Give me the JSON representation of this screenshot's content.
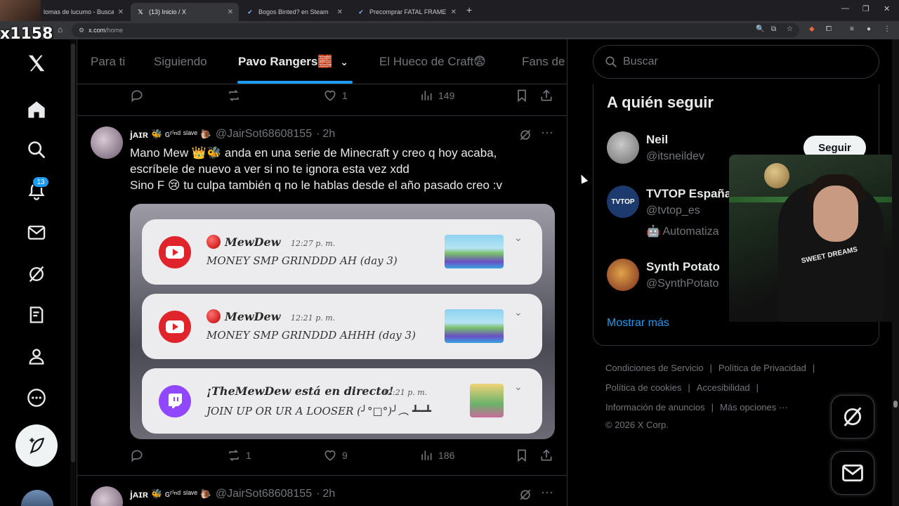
{
  "browser": {
    "tabs": [
      {
        "label": "lomas de lucumo - Buscar c",
        "active": false
      },
      {
        "label": "(13) Inicio / X",
        "active": true
      },
      {
        "label": "Bogos Binted? en Steam",
        "active": false
      },
      {
        "label": "Precomprar FATAL FRAME II: Cr",
        "active": false
      }
    ],
    "url_host": "x.com",
    "url_path": "/home"
  },
  "overlay": {
    "streamer_tag": "x1158"
  },
  "nav": {
    "notifications_badge": "13"
  },
  "timeline": {
    "tabs": [
      "Para ti",
      "Siguiendo",
      "Pavo Rangers🧱",
      "El Hueco de Craft😨",
      "Fans de"
    ],
    "active_tab": "Pavo Rangers🧱",
    "prev_post_actions": {
      "replies": "",
      "reposts": "",
      "likes": "1",
      "views": "149"
    },
    "post": {
      "display_name": "jᴀɪʀ",
      "name_decor": "🐝 ɢʳⁱⁿᵈ ˢˡᵃᵛᵉ 🐌",
      "handle": "@JairSot68608155",
      "time": "2h",
      "text_lines": [
        "Mano Mew 👑🐝 anda en una serie de Minecraft y creo q hoy acaba,",
        "escríbele de nuevo a ver si no te ignora esta vez xdd",
        "Sino F 😢 tu culpa también q no le hablas desde el año pasado creo :v"
      ],
      "notifications": [
        {
          "app": "youtube",
          "who": "MewDew",
          "time": "12:27 p. m.",
          "message": "MONEY SMP GRINDDD AH (day 3)"
        },
        {
          "app": "youtube",
          "who": "MewDew",
          "time": "12:21 p. m.",
          "message": "MONEY SMP GRINDDD AHHH (day 3)"
        },
        {
          "app": "twitch",
          "who": "¡TheMewDew está en directo!",
          "time": "12:21 p. m.",
          "message": "JOIN UP OR UR A LOOSER (╯°□°)╯︵ ┻━┻"
        }
      ],
      "actions": {
        "replies": "",
        "reposts": "1",
        "likes": "9",
        "views": "186"
      }
    },
    "next_post": {
      "display_name": "jᴀɪʀ",
      "name_decor": "🐝 ɢʳⁱⁿᵈ ˢˡᵃᵛᵉ 🐌",
      "handle": "@JairSot68608155",
      "time": "2h"
    }
  },
  "sidebar": {
    "search_placeholder": "Buscar",
    "who_to_follow": {
      "title": "A quién seguir",
      "accounts": [
        {
          "name": "Neil",
          "handle": "@itsneildev",
          "bio": ""
        },
        {
          "name": "TVTOP España",
          "handle": "@tvtop_es",
          "bio": "🤖 Automatiza"
        },
        {
          "name": "Synth Potato",
          "handle": "@SynthPotato",
          "bio": ""
        }
      ],
      "follow_label": "Seguir",
      "show_more": "Mostrar más"
    },
    "footer": {
      "links": [
        "Condiciones de Servicio",
        "Política de Privacidad",
        "Política de cookies",
        "Accesibilidad",
        "Información de anuncios",
        "Más opciones ···"
      ],
      "copyright": "© 2026 X Corp."
    },
    "webcam_shirt_text": "SWEET DREAMS"
  },
  "colors": {
    "accent": "#1d9bf0",
    "background": "#000000",
    "border": "#2f3336",
    "muted": "#71767b"
  }
}
